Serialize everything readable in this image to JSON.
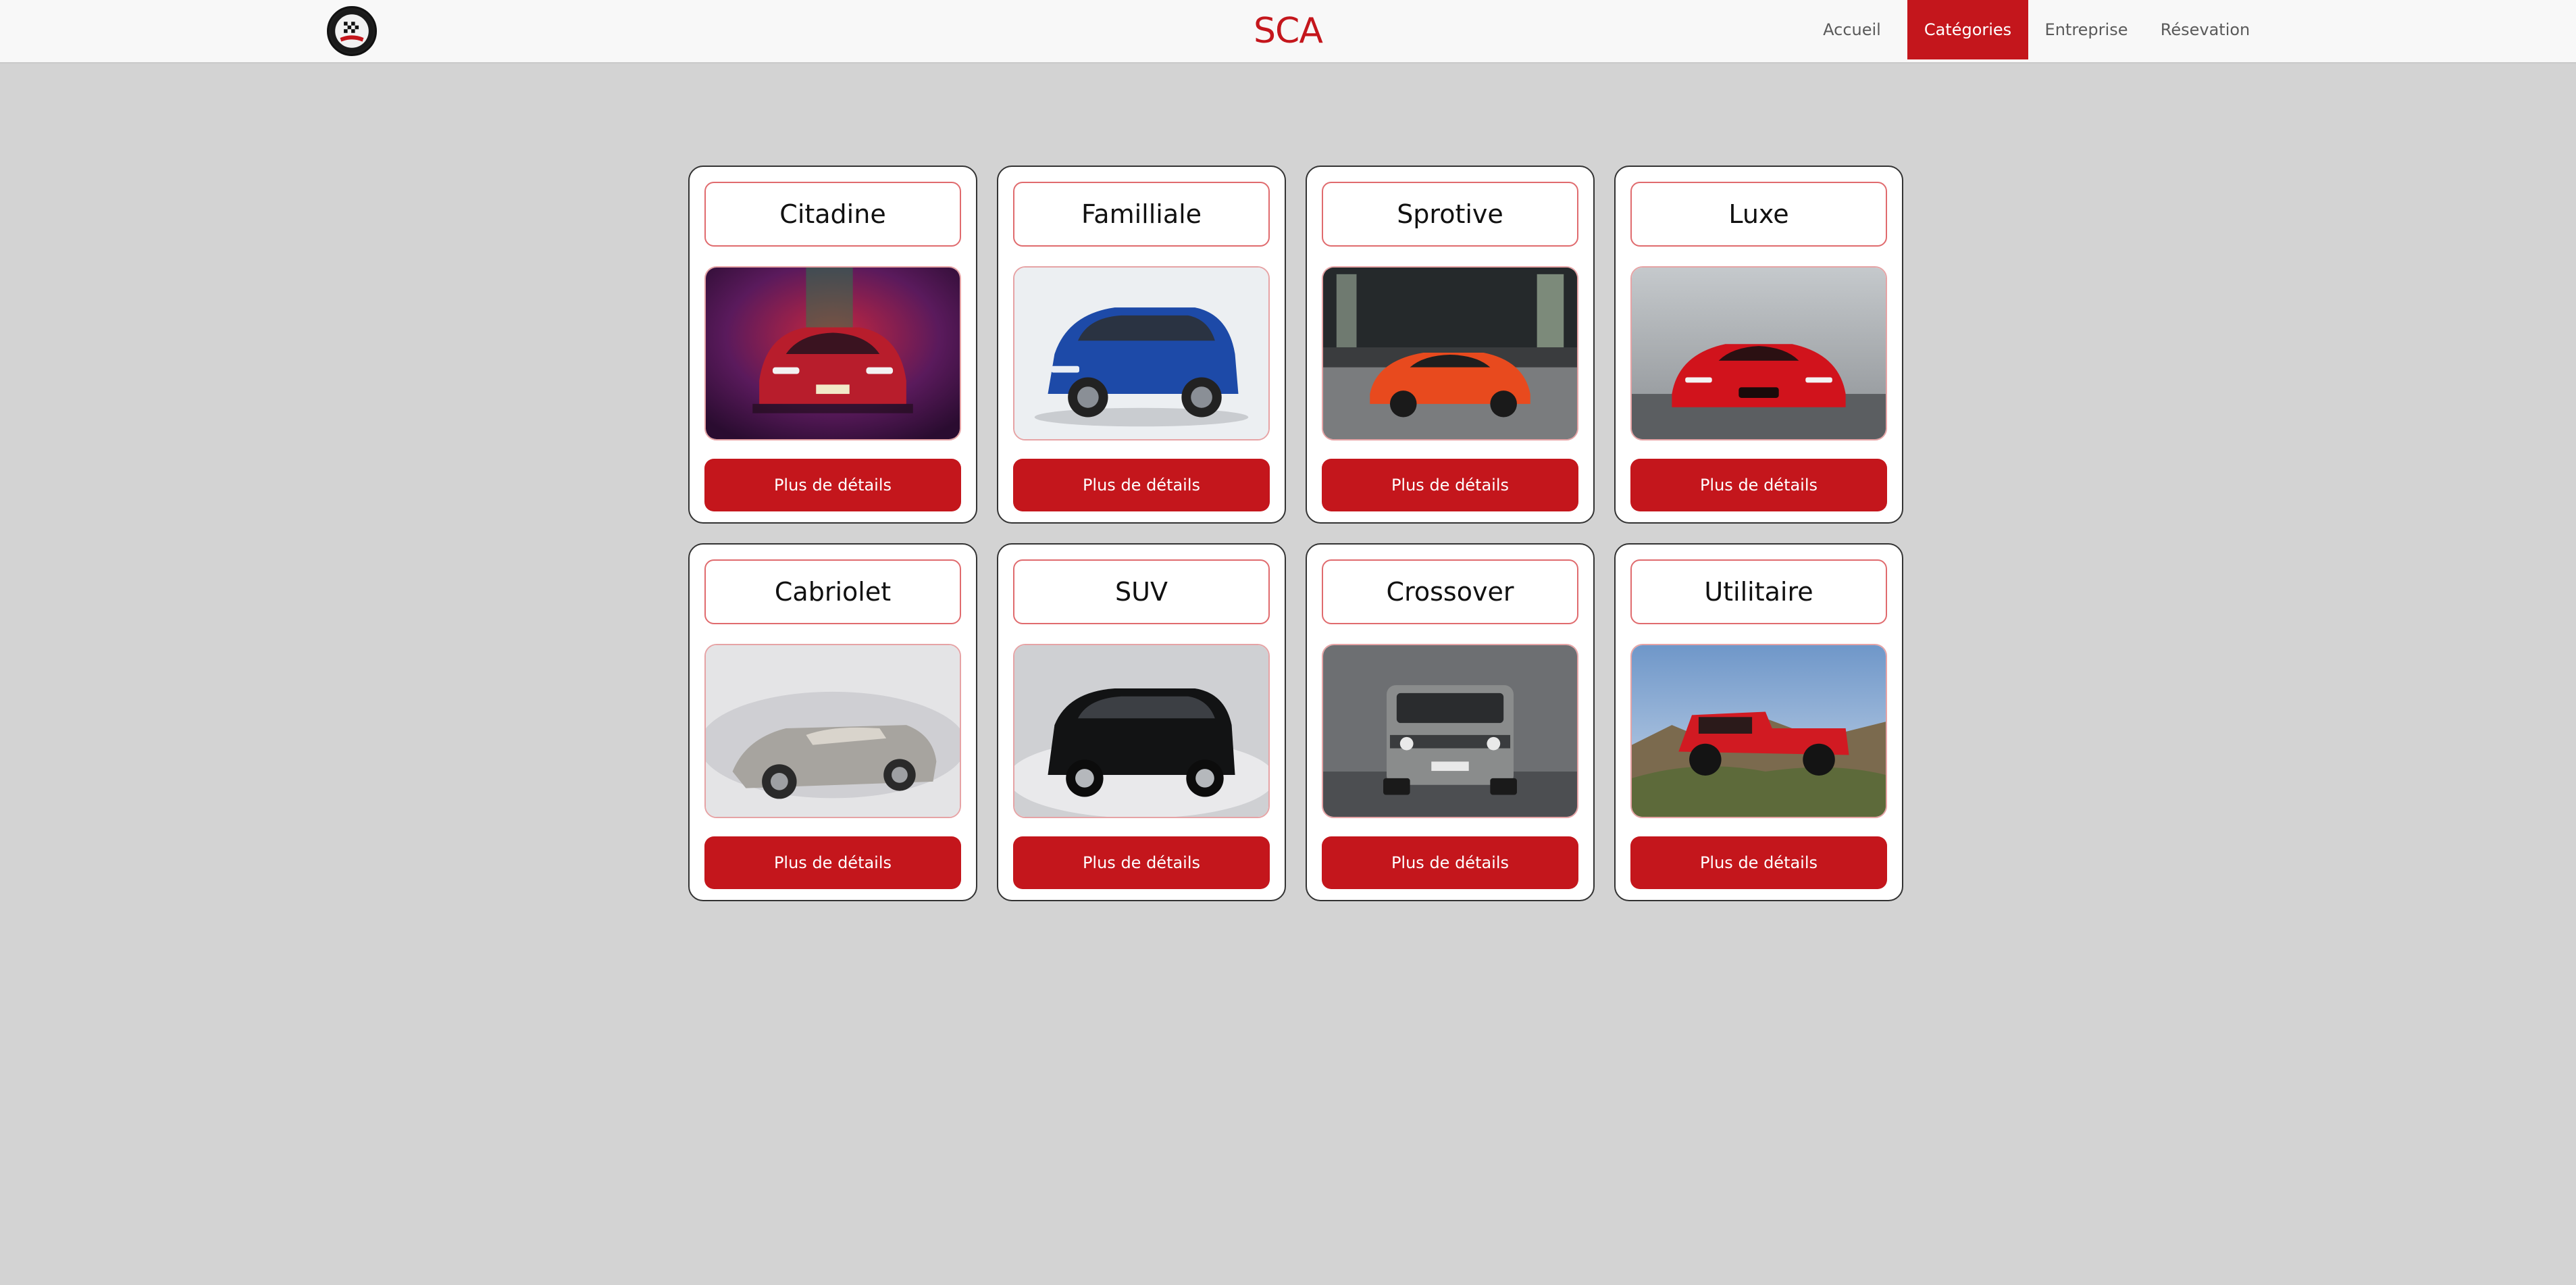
{
  "header": {
    "logo_icon": "rally-club-logo",
    "brand": "SCA",
    "nav": [
      {
        "label": "Accueil",
        "active": false
      },
      {
        "label": "Catégories",
        "active": true
      },
      {
        "label": "Entreprise",
        "active": false
      },
      {
        "label": "Résevation",
        "active": false
      }
    ]
  },
  "colors": {
    "accent": "#c4161c",
    "background": "#d3d3d3",
    "card_border": "#e06b6e"
  },
  "categories": [
    {
      "title": "Citadine",
      "image_icon": "hatchback-car-image",
      "button": "Plus de détails"
    },
    {
      "title": "Familliale",
      "image_icon": "family-suv-image",
      "button": "Plus de détails"
    },
    {
      "title": "Sprotive",
      "image_icon": "sports-car-image",
      "button": "Plus de détails"
    },
    {
      "title": "Luxe",
      "image_icon": "luxury-car-image",
      "button": "Plus de détails"
    },
    {
      "title": "Cabriolet",
      "image_icon": "convertible-car-image",
      "button": "Plus de détails"
    },
    {
      "title": "SUV",
      "image_icon": "suv-car-image",
      "button": "Plus de détails"
    },
    {
      "title": "Crossover",
      "image_icon": "crossover-car-image",
      "button": "Plus de détails"
    },
    {
      "title": "Utilitaire",
      "image_icon": "utility-truck-image",
      "button": "Plus de détails"
    }
  ]
}
